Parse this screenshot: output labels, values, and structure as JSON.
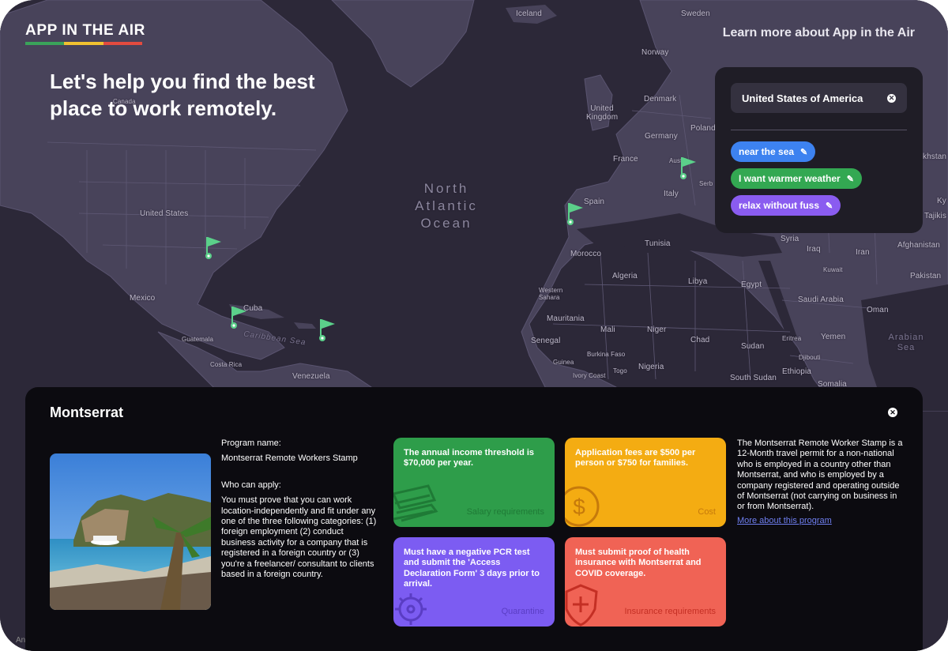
{
  "app": {
    "logo_text": "APP IN THE AIR",
    "logo_stripe_colors": [
      "#3aa35a",
      "#f2c230",
      "#e34b3f"
    ],
    "learn_more": "Learn more about App in the Air"
  },
  "hero": {
    "headline": "Let's help you find the best place to work remotely."
  },
  "map_labels": {
    "iceland": "Iceland",
    "sweden": "Sweden",
    "norway": "Norway",
    "denmark": "Denmark",
    "united_kingdom": "United Kingdom",
    "poland": "Poland",
    "germany": "Germany",
    "france": "France",
    "austria": "Austria",
    "serbia": "Serb",
    "italy": "Italy",
    "spain": "Spain",
    "kazakhstan": "khstan",
    "ky": "Ky",
    "tajikistan": "Tajikis",
    "syria": "Syria",
    "iraq": "Iraq",
    "iran": "Iran",
    "afghanistan": "Afghanistan",
    "tunisia": "Tunisia",
    "morocco": "Morocco",
    "kuwait": "Kuwait",
    "pakistan": "Pakistan",
    "algeria": "Algeria",
    "libya": "Libya",
    "egypt": "Egypt",
    "saudi_arabia": "Saudi Arabia",
    "oman": "Oman",
    "western_sahara": "Western Sahara",
    "mauritania": "Mauritania",
    "mali": "Mali",
    "niger": "Niger",
    "chad": "Chad",
    "sudan": "Sudan",
    "eritrea": "Eritrea",
    "yemen": "Yemen",
    "djibouti": "Djibouti",
    "senegal": "Senegal",
    "guinea": "Guinea",
    "burkina_faso": "Burkina Faso",
    "ivory_coast": "Ivory Coast",
    "togo": "Togo",
    "nigeria": "Nigeria",
    "south_sudan": "South Sudan",
    "ethiopia": "Ethiopia",
    "somalia": "Somalia",
    "canada": "Canada",
    "united_states": "United States",
    "mexico": "Mexico",
    "cuba": "Cuba",
    "guatemala": "Guatemala",
    "costa_rica": "Costa Rica",
    "venezuela": "Venezuela",
    "caribbean_sea": "Caribbean Sea",
    "north_atlantic_ocean": "North Atlantic Ocean",
    "arabian_sea": "Arabian Sea"
  },
  "filters": {
    "country": "United States of America",
    "tags": [
      {
        "label": "near the sea",
        "color": "#3d82f0"
      },
      {
        "label": "I want warmer weather",
        "color": "#33a852"
      },
      {
        "label": "relax without fuss",
        "color": "#8a5cf0"
      }
    ]
  },
  "detail": {
    "title": "Montserrat",
    "program_name_label": "Program name:",
    "program_name": "Montserrat Remote Workers Stamp",
    "who_can_apply_label": "Who can apply:",
    "who_can_apply": "You must prove that you can work location-independently and fit under any one of the three following categories: (1) foreign employment (2) conduct business activity for a company that is registered in a foreign country or (3) you're a freelancer/ consultant to clients based in a foreign country.",
    "cards": [
      {
        "text": "The annual income threshold is $70,000 per year.",
        "label": "Salary requirements",
        "color": "#2e9d4a",
        "icon": "money-stack-icon"
      },
      {
        "text": "Application fees are $500 per person or $750 for families.",
        "label": "Cost",
        "color": "#f4ac12",
        "icon": "dollar-coin-icon"
      },
      {
        "text": "Must have a negative PCR test and submit the 'Access Declaration Form' 3 days prior to arrival.",
        "label": "Quarantine",
        "color": "#7c5cf2",
        "icon": "virus-icon"
      },
      {
        "text": "Must submit proof of health insurance with Montserrat and COVID coverage.",
        "label": "Insurance requirements",
        "color": "#f06355",
        "icon": "shield-cross-icon"
      }
    ],
    "description": "The Montserrat Remote Worker Stamp is a 12-Month travel permit for a non-national who is employed in a country other than Montserrat, and who is employed by a company registered and operating outside of Montserrat (not carrying on business in or from Montserrat).",
    "more_link": "More about this program"
  },
  "corner_text": "An"
}
